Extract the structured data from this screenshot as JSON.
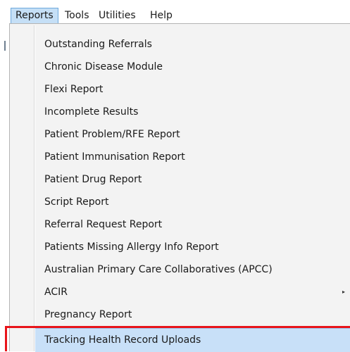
{
  "menubar": {
    "items": [
      {
        "label": "Reports",
        "active": true
      },
      {
        "label": "Tools",
        "active": false
      },
      {
        "label": "Utilities",
        "active": false
      },
      {
        "label": "Help",
        "active": false
      }
    ]
  },
  "reports_menu": {
    "items": [
      {
        "label": "Outstanding Referrals"
      },
      {
        "label": "Chronic Disease Module"
      },
      {
        "label": "Flexi Report"
      },
      {
        "label": "Incomplete Results"
      },
      {
        "label": "Patient Problem/RFE Report"
      },
      {
        "label": "Patient Immunisation Report"
      },
      {
        "label": "Patient Drug Report"
      },
      {
        "label": "Script Report"
      },
      {
        "label": "Referral Request Report"
      },
      {
        "label": "Patients Missing Allergy Info Report"
      },
      {
        "label": "Australian Primary Care Collaboratives (APCC)"
      },
      {
        "label": "ACIR",
        "submenu_arrow": "▸"
      },
      {
        "label": "Pregnancy Report"
      },
      {
        "label": "Tracking Health Record Uploads",
        "highlighted": true
      }
    ]
  },
  "colors": {
    "highlight": "#c8e0f8",
    "annotation_box": "#e8141a",
    "menu_background": "#f3f3f3"
  }
}
